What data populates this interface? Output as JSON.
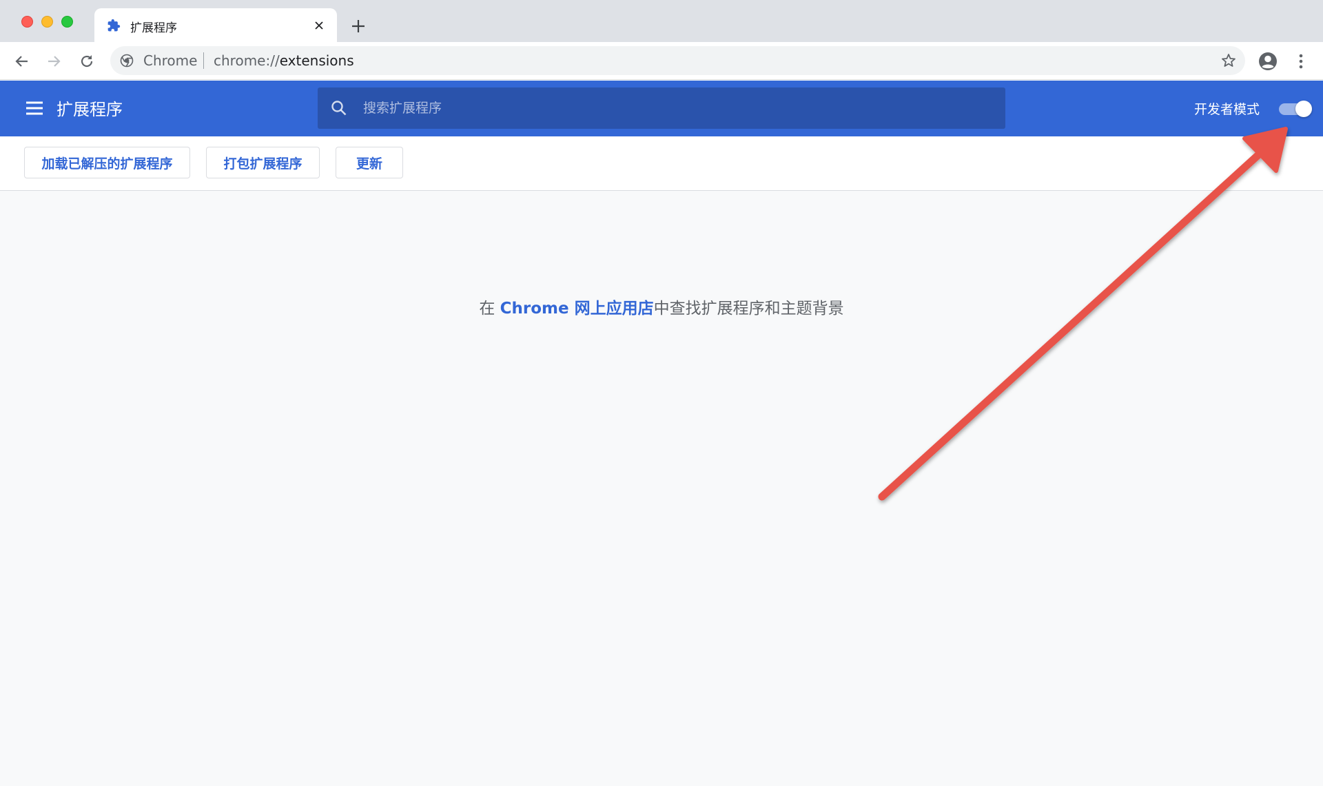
{
  "tab": {
    "title": "扩展程序",
    "icon": "puzzle-icon"
  },
  "omnibox": {
    "site_label": "Chrome",
    "url_scheme": "chrome://",
    "url_path": "extensions"
  },
  "header": {
    "title": "扩展程序",
    "search_placeholder": "搜索扩展程序",
    "dev_mode_label": "开发者模式",
    "dev_mode_on": true
  },
  "actions": {
    "load_unpacked": "加载已解压的扩展程序",
    "pack": "打包扩展程序",
    "update": "更新"
  },
  "main": {
    "prefix": "在 ",
    "link": "Chrome 网上应用店",
    "suffix": "中查找扩展程序和主题背景"
  },
  "colors": {
    "accent": "#3367d6",
    "search_bg": "#2a53ac",
    "annotation_arrow": "#e8534a"
  }
}
